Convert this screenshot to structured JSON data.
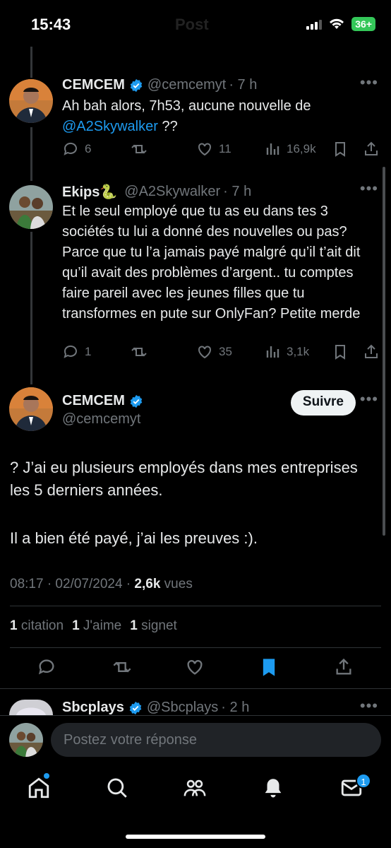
{
  "status_bar": {
    "time": "15:43",
    "battery": "36+",
    "page_title": "Post"
  },
  "tweets": [
    {
      "name": "CEMCEM",
      "handle": "@cemcemyt",
      "age": "· 7 h",
      "text_plain": "Ah bah alors, 7h53, aucune nouvelle de ",
      "mention": "@A2Skywalker",
      "text_after": " ??",
      "replies": "6",
      "likes": "11",
      "views": "16,9k"
    },
    {
      "name": "Ekips🐍",
      "handle": "@A2Skywalker",
      "age": "· 7 h",
      "text": "Et le seul employé que tu as eu dans tes 3 sociétés tu lui a donné des nouvelles ou pas? Parce que tu l’a jamais payé  malgré qu’il t’ait dit qu’il avait des problèmes d’argent.. tu comptes faire pareil avec les jeunes filles que tu transformes en pute sur OnlyFan? Petite merde",
      "replies": "1",
      "likes": "35",
      "views": "3,1k"
    }
  ],
  "main_tweet": {
    "name": "CEMCEM",
    "handle": "@cemcemyt",
    "follow_label": "Suivre",
    "paragraph1": "? J’ai eu plusieurs employés dans mes entreprises les 5 derniers années.",
    "paragraph2": "Il a bien été payé, j’ai les preuves :).",
    "timestamp": "08:17 · 02/07/2024 · ",
    "views_count": "2,6k",
    "views_label": " vues",
    "stats": [
      {
        "count": "1",
        "label": " citation"
      },
      {
        "count": "1",
        "label": " J'aime"
      },
      {
        "count": "1",
        "label": " signet"
      }
    ]
  },
  "next_tweet": {
    "name": "Sbcplays",
    "handle": "@Sbcplays",
    "age": "· 2 h"
  },
  "reply": {
    "placeholder": "Postez votre réponse"
  },
  "tabbar": {
    "messages_badge": "1"
  },
  "colors": {
    "accent": "#1d9bf0",
    "muted": "#71767b",
    "text": "#e7e9ea",
    "background": "#000000"
  },
  "icons": [
    "reply-icon",
    "retweet-icon",
    "like-icon",
    "views-icon",
    "bookmark-icon",
    "share-icon",
    "verified-icon",
    "home-icon",
    "search-icon",
    "communities-icon",
    "notifications-icon",
    "messages-icon"
  ]
}
